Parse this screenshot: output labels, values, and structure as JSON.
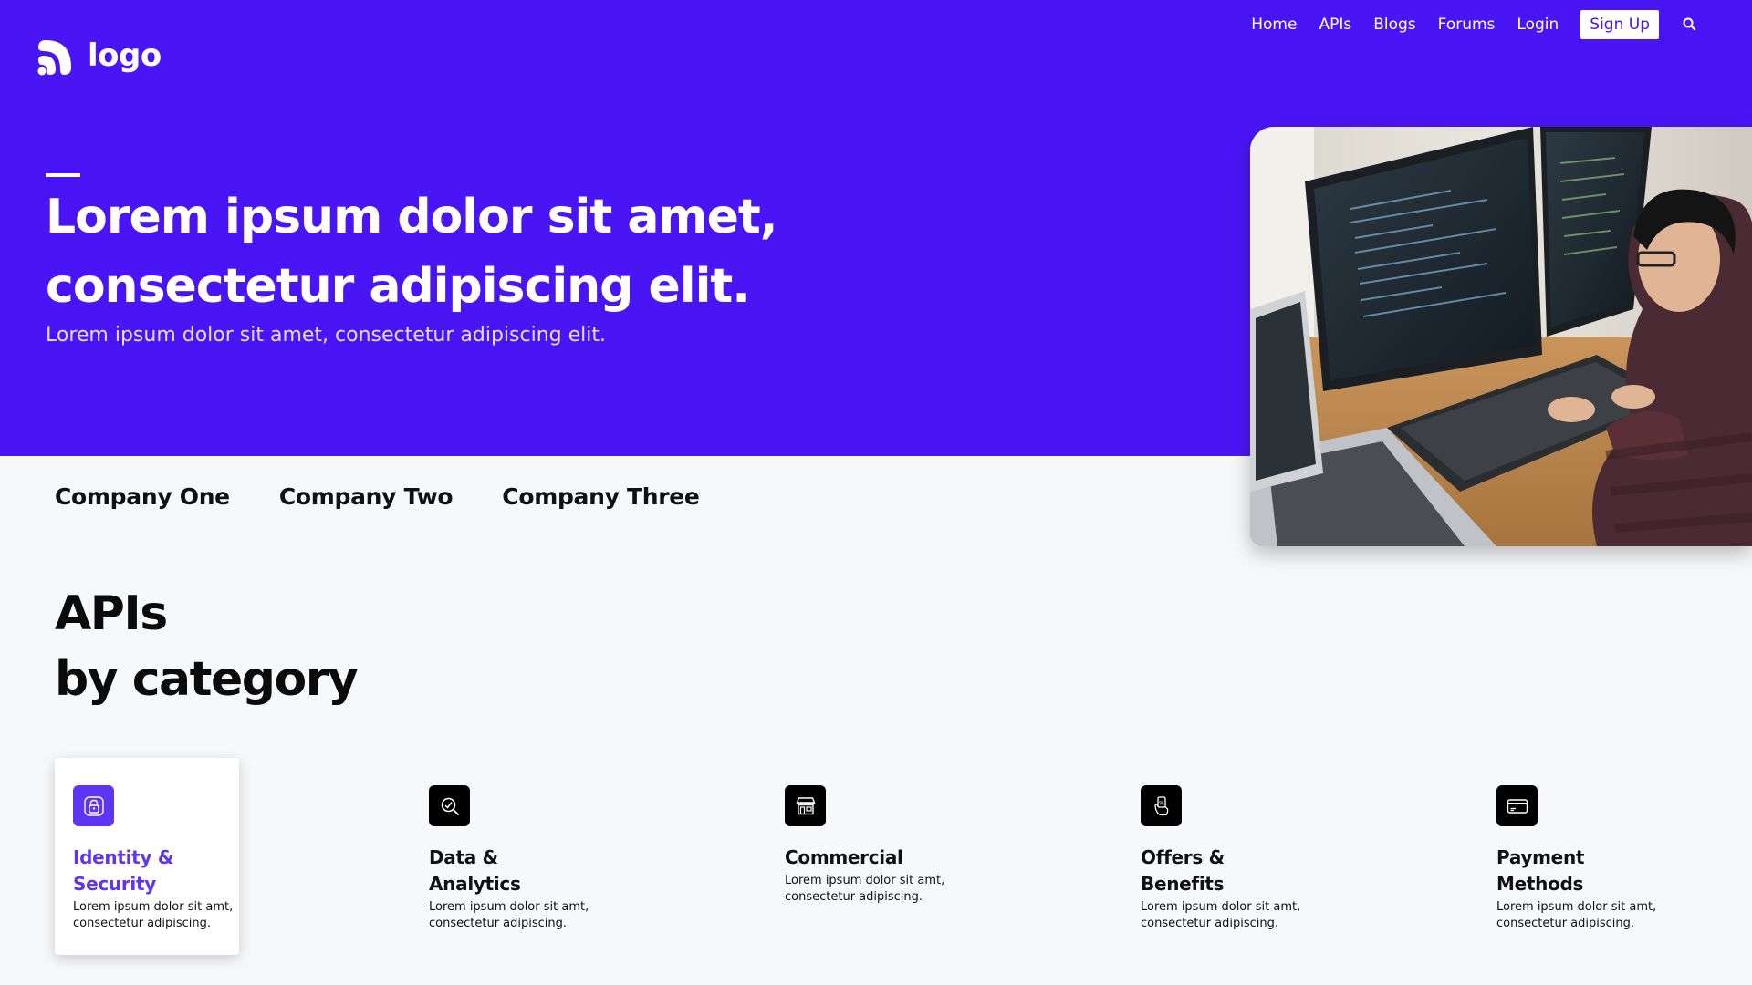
{
  "brand": {
    "logo_text": "logo",
    "accent": "#4a15f5",
    "active_accent": "#5f35f5"
  },
  "nav": {
    "items": [
      "Home",
      "APIs",
      "Blogs",
      "Forums",
      "Login"
    ],
    "signup_label": "Sign Up",
    "search_icon": "search-icon"
  },
  "hero": {
    "title_line1": "Lorem ipsum dolor sit amet,",
    "title_line2": "consectetur adipiscing elit.",
    "subtitle": "Lorem ipsum dolor sit amet, consectetur adipiscing elit."
  },
  "companies": [
    "Company One",
    "Company Two",
    "Company Three"
  ],
  "apis": {
    "title_line1": "APIs",
    "title_line2": "by category",
    "categories": [
      {
        "title": "Identity & Security",
        "desc": "Lorem ipsum dolor sit amt, consectetur adipiscing.",
        "icon": "lock-icon",
        "active": true
      },
      {
        "title": "Data & Analytics",
        "desc": "Lorem ipsum dolor sit amt, consectetur adipiscing.",
        "icon": "analytics-icon",
        "active": false
      },
      {
        "title": "Commercial",
        "desc": "Lorem ipsum dolor sit amt, consectetur adipiscing.",
        "icon": "storefront-icon",
        "active": false
      },
      {
        "title": "Offers & Benefits",
        "desc": "Lorem ipsum dolor sit amt, consectetur adipiscing.",
        "icon": "offer-hand-icon",
        "active": false
      },
      {
        "title": "Payment Methods",
        "desc": "Lorem ipsum dolor sit amt, consectetur adipiscing.",
        "icon": "credit-card-icon",
        "active": false
      }
    ]
  }
}
